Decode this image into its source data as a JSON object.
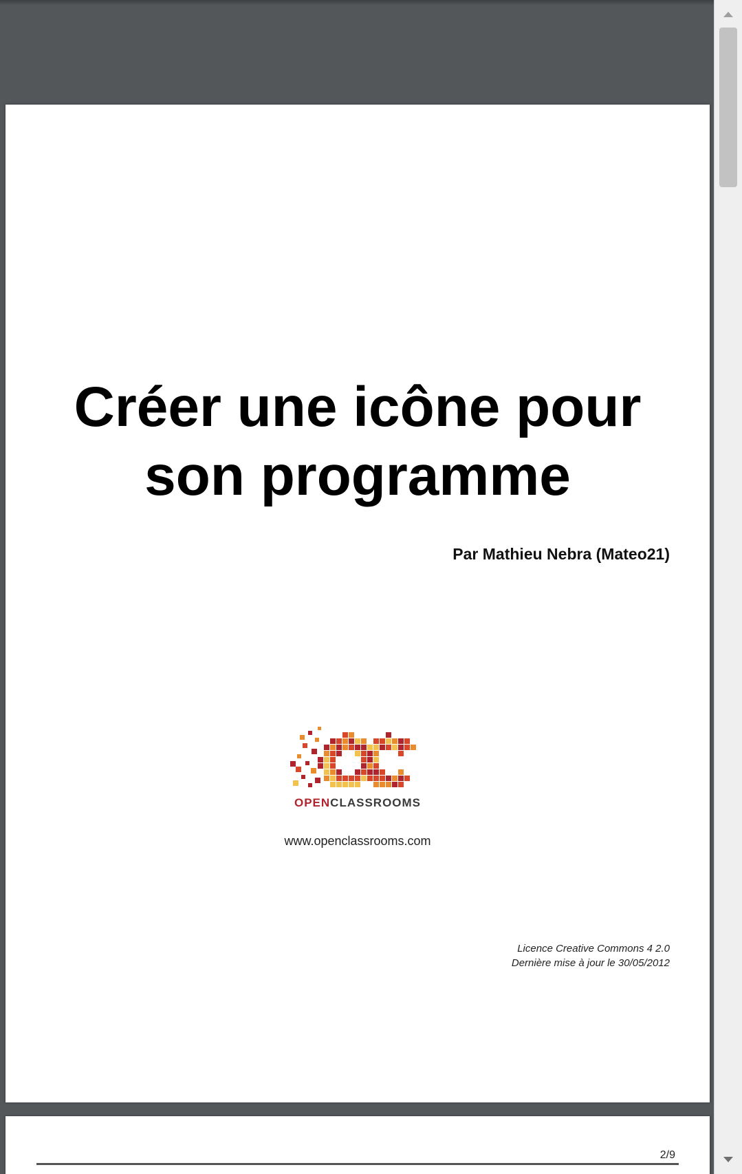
{
  "document": {
    "title_line1": "Créer une icône pour",
    "title_line2": "son programme",
    "author": "Par Mathieu Nebra (Mateo21)",
    "logo": {
      "word_open": "OPEN",
      "word_classrooms": "CLASSROOMS",
      "brand_colors": [
        "#b0242e",
        "#d9472b",
        "#e98c2e",
        "#f2c14e"
      ]
    },
    "website": "www.openclassrooms.com",
    "license_line1": "Licence Creative Commons 4 2.0",
    "license_line2": "Dernière mise à jour le 30/05/2012",
    "page_indicator": "2/9"
  },
  "scrollbar": {
    "up_icon": "arrow-up-icon",
    "down_icon": "arrow-down-icon"
  }
}
